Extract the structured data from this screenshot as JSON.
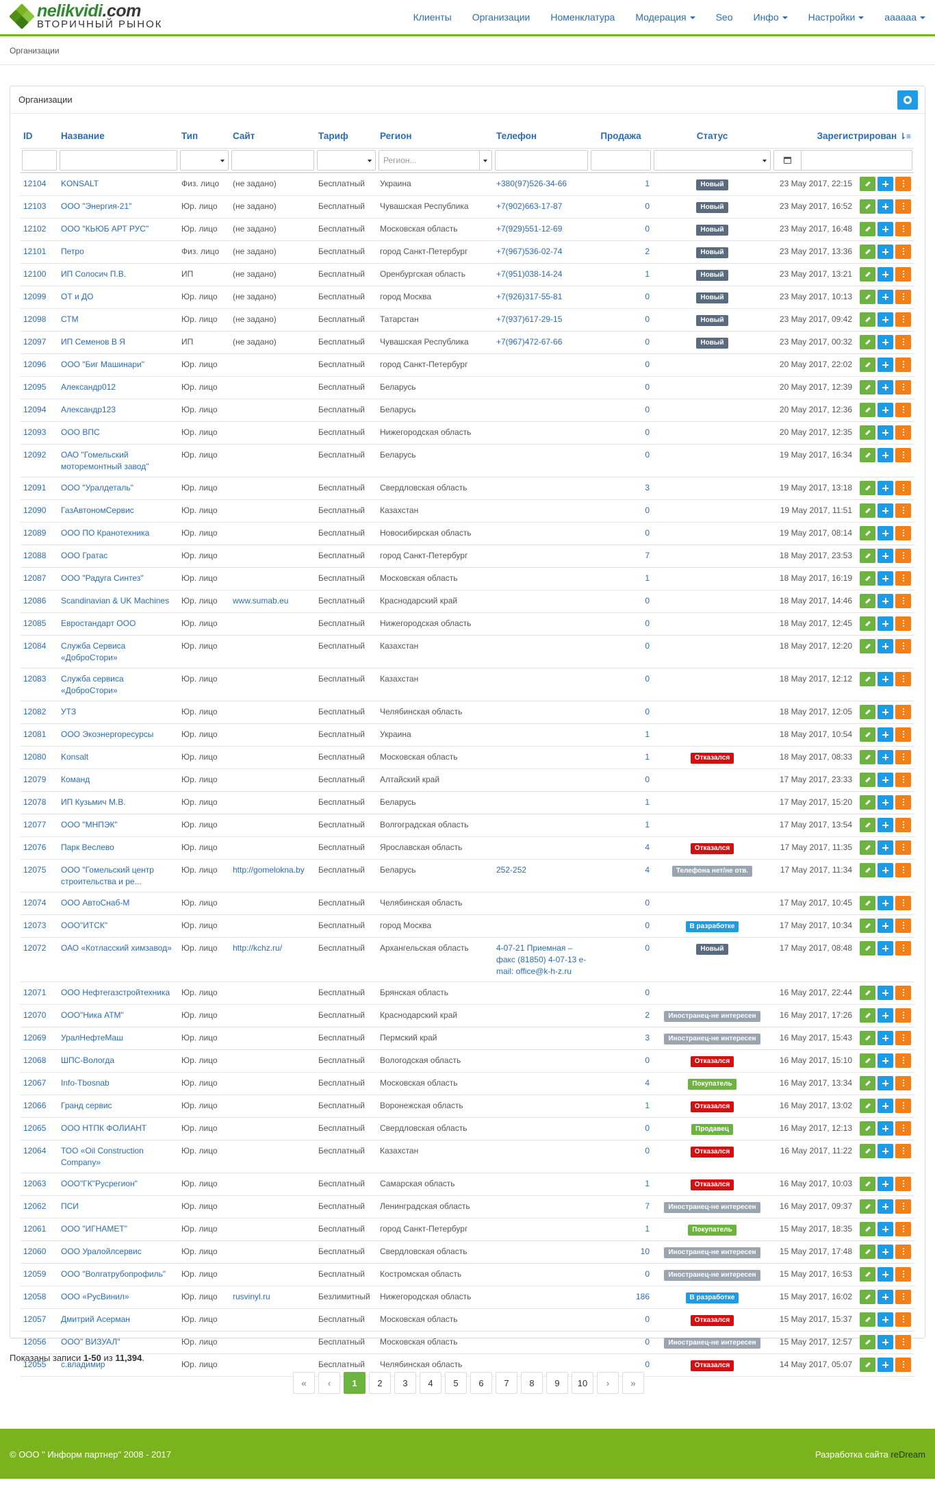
{
  "logo": {
    "text_main": "nelikvidi",
    "text_dot": ".com",
    "text_sub": "ВТОРИЧНЫЙ РЫНОК"
  },
  "nav": [
    {
      "label": "Клиенты",
      "dropdown": false
    },
    {
      "label": "Организации",
      "dropdown": false
    },
    {
      "label": "Номенклатура",
      "dropdown": false
    },
    {
      "label": "Модерация",
      "dropdown": true
    },
    {
      "label": "Seo",
      "dropdown": false
    },
    {
      "label": "Инфо",
      "dropdown": true
    },
    {
      "label": "Настройки",
      "dropdown": true
    },
    {
      "label": "aaaaaa",
      "dropdown": true
    }
  ],
  "breadcrumb": "Организации",
  "panel": {
    "title": "Организации"
  },
  "columns": [
    "ID",
    "Название",
    "Тип",
    "Сайт",
    "Тариф",
    "Регион",
    "Телефон",
    "Продажа",
    "Статус",
    "Зарегистрирован"
  ],
  "filters": {
    "region_placeholder": "Регион..."
  },
  "badge_colors": {
    "new": "#5a6b7f",
    "ref": "#d40f0f",
    "grey": "#9aa5b0",
    "blue": "#1d9ce5",
    "green": "#6db33f"
  },
  "rows": [
    [
      "12104",
      "KONSALT",
      "Физ. лицо",
      "(не задано)",
      "Бесплатный",
      "Украина",
      "+380(97)526-34-66",
      "1",
      "Новый",
      "new",
      "23 May 2017, 22:15"
    ],
    [
      "12103",
      "ООО \"Энергия-21\"",
      "Юр. лицо",
      "(не задано)",
      "Бесплатный",
      "Чувашская Республика",
      "+7(902)663-17-87",
      "0",
      "Новый",
      "new",
      "23 May 2017, 16:52"
    ],
    [
      "12102",
      "ООО \"КЬЮБ АРТ РУС\"",
      "Юр. лицо",
      "(не задано)",
      "Бесплатный",
      "Московская область",
      "+7(929)551-12-69",
      "0",
      "Новый",
      "new",
      "23 May 2017, 16:48"
    ],
    [
      "12101",
      "Петро",
      "Физ. лицо",
      "(не задано)",
      "Бесплатный",
      "город Санкт-Петербург",
      "+7(967)536-02-74",
      "2",
      "Новый",
      "new",
      "23 May 2017, 13:36"
    ],
    [
      "12100",
      "ИП Солосич П.В.",
      "ИП",
      "(не задано)",
      "Бесплатный",
      "Оренбургская область",
      "+7(951)038-14-24",
      "1",
      "Новый",
      "new",
      "23 May 2017, 13:21"
    ],
    [
      "12099",
      "ОТ и ДО",
      "Юр. лицо",
      "(не задано)",
      "Бесплатный",
      "город Москва",
      "+7(926)317-55-81",
      "0",
      "Новый",
      "new",
      "23 May 2017, 10:13"
    ],
    [
      "12098",
      "СТМ",
      "Юр. лицо",
      "(не задано)",
      "Бесплатный",
      "Татарстан",
      "+7(937)617-29-15",
      "0",
      "Новый",
      "new",
      "23 May 2017, 09:42"
    ],
    [
      "12097",
      "ИП Семенов В Я",
      "ИП",
      "(не задано)",
      "Бесплатный",
      "Чувашская Республика",
      "+7(967)472-67-66",
      "0",
      "Новый",
      "new",
      "23 May 2017, 00:32"
    ],
    [
      "12096",
      "ООО \"Биг Машинари\"",
      "Юр. лицо",
      "",
      "Бесплатный",
      "город Санкт-Петербург",
      "",
      "0",
      "",
      "",
      "20 May 2017, 22:02"
    ],
    [
      "12095",
      "Александр012",
      "Юр. лицо",
      "",
      "Бесплатный",
      "Беларусь",
      "",
      "0",
      "",
      "",
      "20 May 2017, 12:39"
    ],
    [
      "12094",
      "Александр123",
      "Юр. лицо",
      "",
      "Бесплатный",
      "Беларусь",
      "",
      "0",
      "",
      "",
      "20 May 2017, 12:36"
    ],
    [
      "12093",
      "ООО ВПС",
      "Юр. лицо",
      "",
      "Бесплатный",
      "Нижегородская область",
      "",
      "0",
      "",
      "",
      "20 May 2017, 12:35"
    ],
    [
      "12092",
      "ОАО \"Гомельский моторемонтный завод\"",
      "Юр. лицо",
      "",
      "Бесплатный",
      "Беларусь",
      "",
      "0",
      "",
      "",
      "19 May 2017, 16:34"
    ],
    [
      "12091",
      "ООО \"Уралдеталь\"",
      "Юр. лицо",
      "",
      "Бесплатный",
      "Свердловская область",
      "",
      "3",
      "",
      "",
      "19 May 2017, 13:18"
    ],
    [
      "12090",
      "ГазАвтономСервис",
      "Юр. лицо",
      "",
      "Бесплатный",
      "Казахстан",
      "",
      "0",
      "",
      "",
      "19 May 2017, 11:51"
    ],
    [
      "12089",
      "ООО ПО Кранотехника",
      "Юр. лицо",
      "",
      "Бесплатный",
      "Новосибирская область",
      "",
      "0",
      "",
      "",
      "19 May 2017, 08:14"
    ],
    [
      "12088",
      "ООО Гратас",
      "Юр. лицо",
      "",
      "Бесплатный",
      "город Санкт-Петербург",
      "",
      "7",
      "",
      "",
      "18 May 2017, 23:53"
    ],
    [
      "12087",
      "ООО \"Радуга Синтез\"",
      "Юр. лицо",
      "",
      "Бесплатный",
      "Московская область",
      "",
      "1",
      "",
      "",
      "18 May 2017, 16:19"
    ],
    [
      "12086",
      "Scandinavian & UK Machines",
      "Юр. лицо",
      "www.sumab.eu",
      "Бесплатный",
      "Краснодарский край",
      "",
      "0",
      "",
      "",
      "18 May 2017, 14:46"
    ],
    [
      "12085",
      "Евростандарт ООО",
      "Юр. лицо",
      "",
      "Бесплатный",
      "Нижегородская область",
      "",
      "0",
      "",
      "",
      "18 May 2017, 12:45"
    ],
    [
      "12084",
      "Служба Сервиса «ДоброСтори»",
      "Юр. лицо",
      "",
      "Бесплатный",
      "Казахстан",
      "",
      "0",
      "",
      "",
      "18 May 2017, 12:20"
    ],
    [
      "12083",
      "Служба сервиса «ДоброСтори»",
      "Юр. лицо",
      "",
      "Бесплатный",
      "Казахстан",
      "",
      "0",
      "",
      "",
      "18 May 2017, 12:12"
    ],
    [
      "12082",
      "УТЗ",
      "Юр. лицо",
      "",
      "Бесплатный",
      "Челябинская область",
      "",
      "0",
      "",
      "",
      "18 May 2017, 12:05"
    ],
    [
      "12081",
      "ООО Экоэнергоресурсы",
      "Юр. лицо",
      "",
      "Бесплатный",
      "Украина",
      "",
      "1",
      "",
      "",
      "18 May 2017, 10:54"
    ],
    [
      "12080",
      "Konsalt",
      "Юр. лицо",
      "",
      "Бесплатный",
      "Московская область",
      "",
      "1",
      "Отказался",
      "ref",
      "18 May 2017, 08:33"
    ],
    [
      "12079",
      "Команд",
      "Юр. лицо",
      "",
      "Бесплатный",
      "Алтайский край",
      "",
      "0",
      "",
      "",
      "17 May 2017, 23:33"
    ],
    [
      "12078",
      "ИП Кузьмич М.В.",
      "Юр. лицо",
      "",
      "Бесплатный",
      "Беларусь",
      "",
      "1",
      "",
      "",
      "17 May 2017, 15:20"
    ],
    [
      "12077",
      "ООО \"МНПЭК\"",
      "Юр. лицо",
      "",
      "Бесплатный",
      "Волгоградская область",
      "",
      "1",
      "",
      "",
      "17 May 2017, 13:54"
    ],
    [
      "12076",
      "Парк Веслево",
      "Юр. лицо",
      "",
      "Бесплатный",
      "Ярославская область",
      "",
      "4",
      "Отказался",
      "ref",
      "17 May 2017, 11:35"
    ],
    [
      "12075",
      "ООО \"Гомельский центр строительства и ре...",
      "Юр. лицо",
      "http://gomelokna.by",
      "Бесплатный",
      "Беларусь",
      "252-252",
      "4",
      "Телефона нет/не отв.",
      "grey",
      "17 May 2017, 11:34"
    ],
    [
      "12074",
      "ООО АвтоСнаб-М",
      "Юр. лицо",
      "",
      "Бесплатный",
      "Челябинская область",
      "",
      "0",
      "",
      "",
      "17 May 2017, 10:45"
    ],
    [
      "12073",
      "ООО\"ИТСК\"",
      "Юр. лицо",
      "",
      "Бесплатный",
      "город Москва",
      "",
      "0",
      "В разработке",
      "blue",
      "17 May 2017, 10:34"
    ],
    [
      "12072",
      "ОАО «Котласский химзавод»",
      "Юр. лицо",
      "http://kchz.ru/",
      "Бесплатный",
      "Архангельская область",
      "4-07-21 Приемная – факс (81850) 4-07-13 e-mail: office@k-h-z.ru",
      "0",
      "Новый",
      "new",
      "17 May 2017, 08:48"
    ],
    [
      "12071",
      "ООО Нефтегазстройтехника",
      "Юр. лицо",
      "",
      "Бесплатный",
      "Брянская область",
      "",
      "0",
      "",
      "",
      "16 May 2017, 22:44"
    ],
    [
      "12070",
      "ООО\"Ника АТМ\"",
      "Юр. лицо",
      "",
      "Бесплатный",
      "Краснодарский край",
      "",
      "2",
      "Иностранец-не интересен",
      "grey",
      "16 May 2017, 17:26"
    ],
    [
      "12069",
      "УралНефтеМаш",
      "Юр. лицо",
      "",
      "Бесплатный",
      "Пермский край",
      "",
      "3",
      "Иностранец-не интересен",
      "grey",
      "16 May 2017, 15:43"
    ],
    [
      "12068",
      "ШПС-Вологда",
      "Юр. лицо",
      "",
      "Бесплатный",
      "Вологодская область",
      "",
      "0",
      "Отказался",
      "ref",
      "16 May 2017, 15:10"
    ],
    [
      "12067",
      "Info-Tbosnab",
      "Юр. лицо",
      "",
      "Бесплатный",
      "Московская область",
      "",
      "4",
      "Покупатель",
      "green",
      "16 May 2017, 13:34"
    ],
    [
      "12066",
      "Гранд сервис",
      "Юр. лицо",
      "",
      "Бесплатный",
      "Воронежская область",
      "",
      "1",
      "Отказался",
      "ref",
      "16 May 2017, 13:02"
    ],
    [
      "12065",
      "ООО НТПК ФОЛИАНТ",
      "Юр. лицо",
      "",
      "Бесплатный",
      "Свердловская область",
      "",
      "0",
      "Продавец",
      "green",
      "16 May 2017, 12:13"
    ],
    [
      "12064",
      "ТОО «Oil Construction Company»",
      "Юр. лицо",
      "",
      "Бесплатный",
      "Казахстан",
      "",
      "0",
      "Отказался",
      "ref",
      "16 May 2017, 11:22"
    ],
    [
      "12063",
      "ООО\"ГК\"Русрегион\"",
      "Юр. лицо",
      "",
      "Бесплатный",
      "Самарская область",
      "",
      "1",
      "Отказался",
      "ref",
      "16 May 2017, 10:03"
    ],
    [
      "12062",
      "ПСИ",
      "Юр. лицо",
      "",
      "Бесплатный",
      "Ленинградская область",
      "",
      "7",
      "Иностранец-не интересен",
      "grey",
      "16 May 2017, 09:37"
    ],
    [
      "12061",
      "ООО \"ИГНАМЕТ\"",
      "Юр. лицо",
      "",
      "Бесплатный",
      "город Санкт-Петербург",
      "",
      "1",
      "Покупатель",
      "green",
      "15 May 2017, 18:35"
    ],
    [
      "12060",
      "ООО Уралойлсервис",
      "Юр. лицо",
      "",
      "Бесплатный",
      "Свердловская область",
      "",
      "10",
      "Иностранец-не интересен",
      "grey",
      "15 May 2017, 17:48"
    ],
    [
      "12059",
      "ООО \"Волгатрубопрофиль\"",
      "Юр. лицо",
      "",
      "Бесплатный",
      "Костромская область",
      "",
      "0",
      "Иностранец-не интересен",
      "grey",
      "15 May 2017, 16:53"
    ],
    [
      "12058",
      "ООО «РусВинил»",
      "Юр. лицо",
      "rusvinyl.ru",
      "Безлимитный",
      "Нижегородская область",
      "",
      "186",
      "В разработке",
      "blue",
      "15 May 2017, 16:02"
    ],
    [
      "12057",
      "Дмитрий Асерман",
      "Юр. лицо",
      "",
      "Бесплатный",
      "Московская область",
      "",
      "0",
      "Отказался",
      "ref",
      "15 May 2017, 15:37"
    ],
    [
      "12056",
      "ООО\" ВИЗУАЛ\"",
      "Юр. лицо",
      "",
      "Бесплатный",
      "Московская область",
      "",
      "0",
      "Иностранец-не интересен",
      "grey",
      "15 May 2017, 12:57"
    ],
    [
      "12055",
      "с.владимир",
      "Юр. лицо",
      "",
      "Бесплатный",
      "Челябинская область",
      "",
      "0",
      "Отказался",
      "ref",
      "14 May 2017, 05:07"
    ]
  ],
  "summary": {
    "prefix": "Показаны записи ",
    "range": "1-50",
    "of": " из ",
    "total": "11,394",
    "suffix": "."
  },
  "pagination": [
    "«",
    "‹",
    "1",
    "2",
    "3",
    "4",
    "5",
    "6",
    "7",
    "8",
    "9",
    "10",
    "›",
    "»"
  ],
  "pagination_active": "1",
  "footer": {
    "copyright": "© ООО \" Информ партнер\" 2008 - 2017",
    "dev_prefix": "Разработка сайта ",
    "dev_name": "reDream"
  }
}
